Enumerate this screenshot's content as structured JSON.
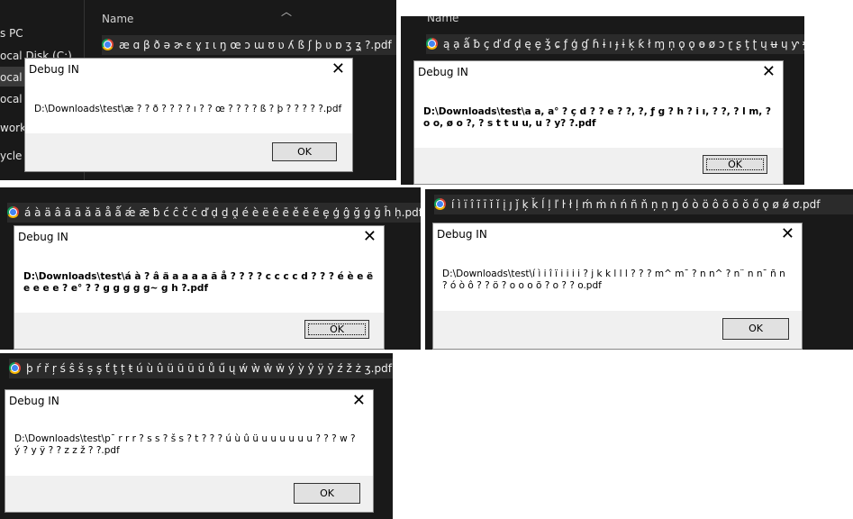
{
  "panels": [
    {
      "id": "p1",
      "header_name": "Name",
      "nav_items": [
        "s PC",
        "ocal Disk (C:)",
        "ocal D",
        "ocal D",
        "work",
        "ycle b"
      ],
      "file_name": "æ ɑ β ð ə ɚ ɛ ɣ ɪ ɩ ŋ œ ɔ ɯ ʊ ʋ ʎ ß ʃ þ ʋ ɒ ʒ ʓ ?.pdf",
      "dialog": {
        "title": "Debug IN",
        "message": "D:\\Downloads\\test\\æ ? ? ð ? ? ? ? ı ? ? œ ? ? ? ? ß ? þ ? ? ? ? ?.pdf",
        "ok_label": "OK"
      }
    },
    {
      "id": "p2",
      "header_name": "Name",
      "file_name": "ą ạ ǻ ƀ ç ď ɗ ḑ ę ȩ ǯ ɕ ƒ ģ ɠ ɦ ɨ ı ɟ ɨ ķ ƙ ł ɱ ņ ǫ ǫ ɵ ø ɔ ɽ ʂ ţ ʈ ų ʉ ɥ ƴ ɏ.pdf",
      "dialog": {
        "title": "Debug IN",
        "message": "D:\\Downloads\\test\\a a, a° ? ç d ? ? e ? ?, ?, ƒ g ? h ? i ı, ? ?, ? l m, ? o o, ø o ?, ? s t t u u, u ? y? ?.pdf",
        "ok_label": "OK"
      }
    },
    {
      "id": "p3",
      "header_name": "Name",
      "file_name": "á à ä â ã ā ǎ ă å ǻ ǽ ǣ ƀ ć ĉ č ċ ď ḍ ḏ ḓ é è ë ê ē ě ĕ ẽ ȩ ģ ĝ ğ ġ ǧ ĥ ḥ.pdf",
      "dialog": {
        "title": "Debug IN",
        "message": "D:\\Downloads\\test\\á à ? â ä a a a a ã å ? ? ? ? c c c c d ? ? ? é è e ë e e e e ? e° ? ? g g g g g~ g h ?.pdf",
        "ok_label": "OK"
      }
    },
    {
      "id": "p4",
      "file_name": "í ì ï î ĩ ī ĭ ǐ į ȷ ǰ ķ ǩ ĺ ļ ľ ŀ ł ḷ ḿ ṁ ṅ ń ñ ň ņ ṇ ŋ ó ò ö ô õ ō ŏ ő ǫ ø ǿ ơ.pdf",
      "dialog": {
        "title": "Debug IN",
        "message": "D:\\Downloads\\test\\í ì i î ï i i i i ? j k k l l l ? ? ? m^ m¯ ? n n^ ? n¨ n n¯ ñ n ? ó ò ô ? ? ö ? o o o õ ? o ? ? o.pdf",
        "ok_label": "OK"
      }
    },
    {
      "id": "p5",
      "file_name": "þ ŕ ř ŗ ś ŝ š ș ş ť ţ ț ŧ ú ù û ü ũ ū ŭ ů ű ų ẃ ẁ ŵ ẅ ý ỳ ŷ ÿ ȳ ź ž ż ʒ.pdf",
      "dialog": {
        "title": "Debug IN",
        "message": "D:\\Downloads\\test\\p¯ r r r ? s s ? š s ? t ? ? ? ú ù û ü u u u u u u ? ? ? w ? ý ? y ÿ ? ? z z ž ? ?.pdf",
        "ok_label": "OK"
      }
    }
  ]
}
